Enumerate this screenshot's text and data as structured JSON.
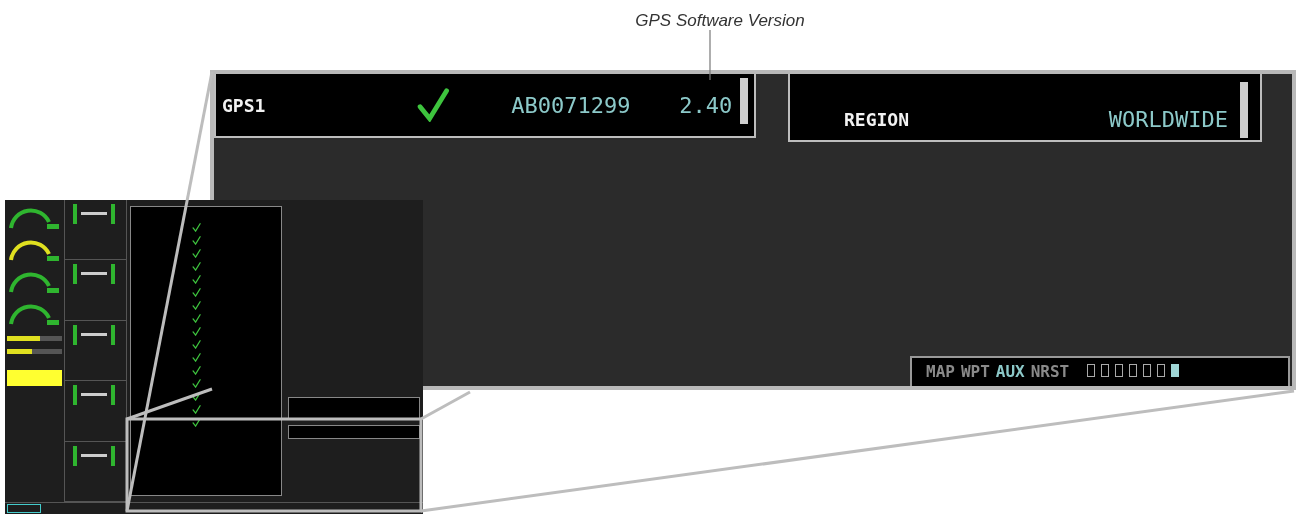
{
  "caption": "GPS Software Version",
  "detail": {
    "lru_row": {
      "name": "GPS1",
      "status_ok": true,
      "serial": "AB0071299",
      "version": "2.40"
    },
    "database": {
      "label": "REGION",
      "value": "WORLDWIDE"
    },
    "page_nav": {
      "groups": [
        {
          "label": "MAP",
          "selected": false
        },
        {
          "label": "WPT",
          "selected": false
        },
        {
          "label": "AUX",
          "selected": true
        },
        {
          "label": "NRST",
          "selected": false
        }
      ],
      "pages": [
        {
          "selected": false
        },
        {
          "selected": false
        },
        {
          "selected": false
        },
        {
          "selected": false
        },
        {
          "selected": false
        },
        {
          "selected": false
        },
        {
          "selected": true
        }
      ]
    }
  },
  "overview": {
    "bars": [
      {
        "level": 0.6
      },
      {
        "level": 0.45
      }
    ],
    "lru_rows": [
      {
        "ok": true
      },
      {
        "ok": true
      },
      {
        "ok": true
      },
      {
        "ok": true
      },
      {
        "ok": true
      },
      {
        "ok": true
      },
      {
        "ok": true
      },
      {
        "ok": true
      },
      {
        "ok": true
      },
      {
        "ok": true
      },
      {
        "ok": true
      },
      {
        "ok": true
      },
      {
        "ok": true
      },
      {
        "ok": true
      },
      {
        "ok": true
      },
      {
        "ok": true
      }
    ]
  }
}
